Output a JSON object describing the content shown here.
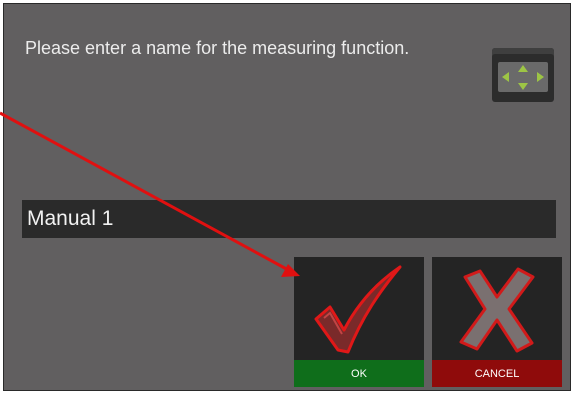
{
  "dialog": {
    "prompt": "Please enter a name for the measuring function.",
    "nav_icon": "move-arrows-icon"
  },
  "name_field": {
    "value": "Manual 1"
  },
  "buttons": {
    "ok": {
      "label": "OK",
      "icon": "checkmark-icon",
      "color": "#0f6e1b"
    },
    "cancel": {
      "label": "CANCEL",
      "icon": "x-icon",
      "color": "#8f0b0b"
    }
  },
  "annotation": {
    "arrow_color": "#e01010"
  },
  "colors": {
    "dialog_bg": "#615f60",
    "input_bg": "#2a2a2a",
    "nav_arrows": "#9dc545"
  }
}
